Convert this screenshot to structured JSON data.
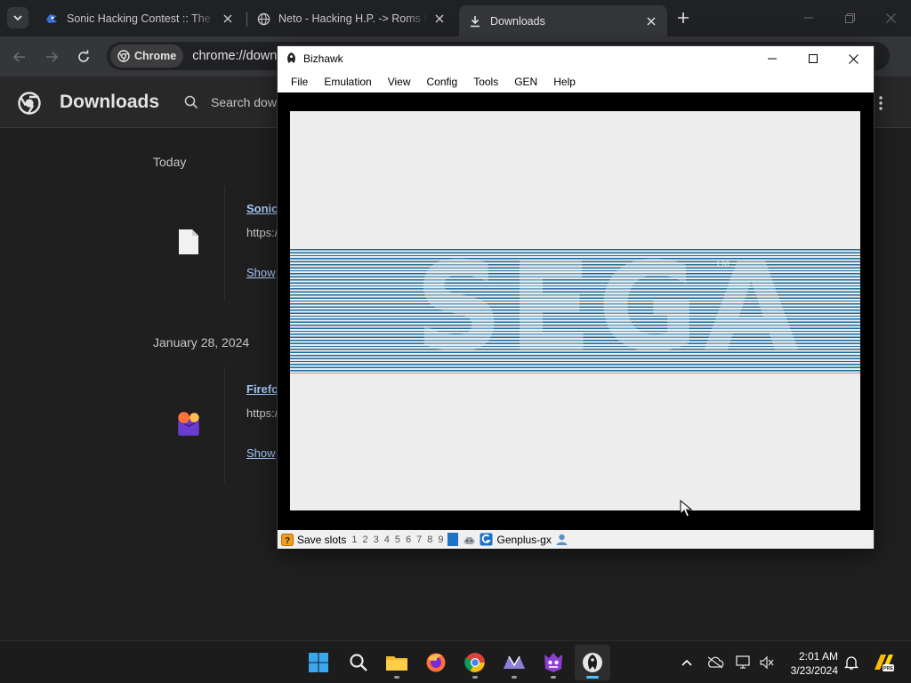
{
  "browser": {
    "tabs": [
      {
        "title": "Sonic Hacking Contest :: The Sh",
        "active": false
      },
      {
        "title": "Neto - Hacking H.P. -> Roms ha",
        "active": false
      },
      {
        "title": "Downloads",
        "active": true
      }
    ],
    "chip_label": "Chrome",
    "url": "chrome://downlo"
  },
  "downloads": {
    "title": "Downloads",
    "search_placeholder": "Search down",
    "sections": [
      {
        "date": "Today",
        "item": {
          "name": "Sonic",
          "source": "https:/",
          "action": "Show"
        }
      },
      {
        "date": "January 28, 2024",
        "item": {
          "name": "Firefo",
          "source": "https:/",
          "action": "Show"
        }
      }
    ]
  },
  "bizhawk": {
    "title": "Bizhawk",
    "menu": [
      "File",
      "Emulation",
      "View",
      "Config",
      "Tools",
      "GEN",
      "Help"
    ],
    "screen_logo": "SEGA",
    "screen_tm": "TM",
    "status": {
      "save_slots_label": "Save slots",
      "slots": [
        "1",
        "2",
        "3",
        "4",
        "5",
        "6",
        "7",
        "8",
        "9"
      ],
      "core": "Genplus-gx"
    },
    "colors": {
      "stripe": "#1e6a98",
      "screen_bg": "#ededed"
    }
  },
  "taskbar": {
    "apps": [
      "start-icon",
      "search-icon",
      "file-explorer-icon",
      "firefox-icon",
      "chrome-icon",
      "app-icon",
      "game-icon",
      "bizhawk-icon"
    ],
    "time": "2:01 AM",
    "date": "3/23/2024"
  }
}
